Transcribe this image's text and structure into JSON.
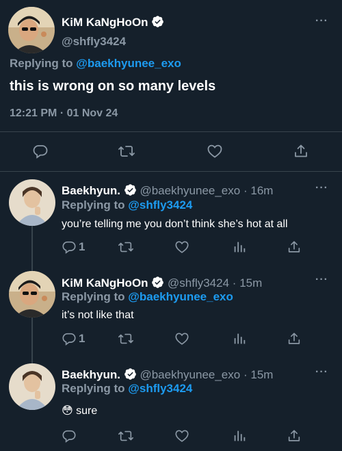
{
  "main_tweet": {
    "name": "KiM KaNgHoOn",
    "handle": "@shfly3424",
    "replying_prefix": "Replying to",
    "replying_to": "@baekhyunee_exo",
    "text": "this is wrong on so many levels",
    "timestamp": "12:21 PM · 01 Nov 24",
    "more_label": "···",
    "actions": [
      "reply-icon",
      "retweet-icon",
      "like-icon",
      "share-icon"
    ]
  },
  "replies": [
    {
      "name": "Baekhyun.",
      "handle": "@baekhyunee_exo",
      "separator": "·",
      "time": "16m",
      "replying_prefix": "Replying to",
      "replying_to": "@shfly3424",
      "text": "you’re telling me you don’t think she’s hot at all",
      "reply_count": "1",
      "more_label": "···"
    },
    {
      "name": "KiM KaNgHoOn",
      "handle": "@shfly3424",
      "separator": "·",
      "time": "15m",
      "replying_prefix": "Replying to",
      "replying_to": "@baekhyunee_exo",
      "text": "it’s not like that",
      "reply_count": "1",
      "more_label": "···"
    },
    {
      "name": "Baekhyun.",
      "handle": "@baekhyunee_exo",
      "separator": "·",
      "time": "15m",
      "replying_prefix": "Replying to",
      "replying_to": "@shfly3424",
      "emoji": "😳",
      "text": "sure",
      "reply_count": "",
      "more_label": "···"
    }
  ],
  "colors": {
    "background": "#15202b",
    "text": "#ffffff",
    "muted": "#8b98a5",
    "link": "#1d9bf0",
    "divider": "#38444d"
  }
}
